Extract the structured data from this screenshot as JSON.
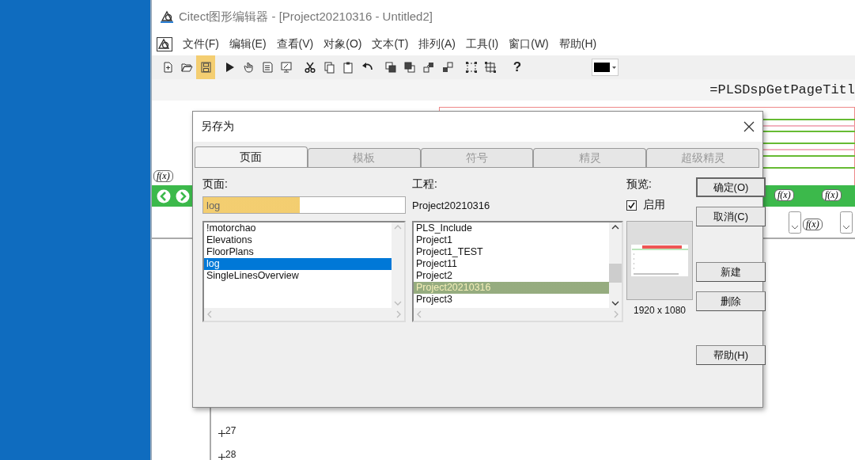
{
  "window": {
    "title": "Citect图形编辑器 - [Project20210316 - Untitled2]"
  },
  "menu": [
    "文件(F)",
    "编辑(E)",
    "查看(V)",
    "对象(O)",
    "文本(T)",
    "排列(A)",
    "工具(I)",
    "窗口(W)",
    "帮助(H)"
  ],
  "toolbar": [
    {
      "kind": "new",
      "highlighted": false
    },
    {
      "kind": "open",
      "highlighted": false
    },
    {
      "kind": "save",
      "highlighted": true
    },
    {
      "kind": "run",
      "highlighted": false
    },
    {
      "kind": "hand",
      "highlighted": false
    },
    {
      "kind": "page",
      "highlighted": false
    },
    {
      "kind": "monitor",
      "highlighted": false
    },
    {
      "kind": "cut",
      "highlighted": false
    },
    {
      "kind": "copy",
      "highlighted": false
    },
    {
      "kind": "paste",
      "highlighted": false
    },
    {
      "kind": "undo",
      "highlighted": false
    },
    {
      "kind": "front",
      "highlighted": false
    },
    {
      "kind": "back",
      "highlighted": false
    },
    {
      "kind": "forward",
      "highlighted": false
    },
    {
      "kind": "backward",
      "highlighted": false
    },
    {
      "kind": "group",
      "highlighted": false
    },
    {
      "kind": "ungroup",
      "highlighted": false
    },
    {
      "kind": "help",
      "label": "?",
      "highlighted": false
    }
  ],
  "formula_bar": {
    "text": "=PLSDspGetPageTitl"
  },
  "canvas": {
    "fx_labels": [
      "f(x)",
      "f(x)",
      "f(x)",
      "f(x)"
    ],
    "row_markers": [
      "27",
      "28"
    ]
  },
  "dialog": {
    "title": "另存为",
    "tabs": [
      {
        "label": "页面",
        "selected": true,
        "disabled": false
      },
      {
        "label": "模板",
        "selected": false,
        "disabled": true
      },
      {
        "label": "符号",
        "selected": false,
        "disabled": true
      },
      {
        "label": "精灵",
        "selected": false,
        "disabled": true
      },
      {
        "label": "超级精灵",
        "selected": false,
        "disabled": true
      }
    ],
    "page": {
      "label": "页面:",
      "field": {
        "value": "log",
        "highlighted": true
      },
      "items": [
        {
          "label": "!motorchao",
          "selected": false
        },
        {
          "label": "Elevations",
          "selected": false
        },
        {
          "label": "FloorPlans",
          "selected": false
        },
        {
          "label": "log",
          "selected": true
        },
        {
          "label": "SingleLinesOverview",
          "selected": false
        }
      ]
    },
    "project": {
      "label": "工程:",
      "value": "Project20210316",
      "items": [
        {
          "label": "PLS_Include",
          "selected": false,
          "highlighted": false
        },
        {
          "label": "Project1",
          "selected": false,
          "highlighted": false
        },
        {
          "label": "Project1_TEST",
          "selected": false,
          "highlighted": false
        },
        {
          "label": "Project11",
          "selected": false,
          "highlighted": false
        },
        {
          "label": "Project2",
          "selected": false,
          "highlighted": false
        },
        {
          "label": "Project20210316",
          "selected": true,
          "highlighted": true
        },
        {
          "label": "Project3",
          "selected": false,
          "highlighted": false
        }
      ]
    },
    "preview": {
      "label": "预览:",
      "enable": {
        "label": "启用",
        "checked": true
      },
      "resolution": "1920 x 1080"
    },
    "buttons": [
      {
        "label": "确定(O)",
        "kind": "default"
      },
      {
        "label": "取消(C)",
        "kind": "normal"
      },
      {
        "label": "新建",
        "kind": "normal"
      },
      {
        "label": "删除",
        "kind": "normal"
      },
      {
        "label": "帮助(H)",
        "kind": "normal"
      }
    ]
  }
}
